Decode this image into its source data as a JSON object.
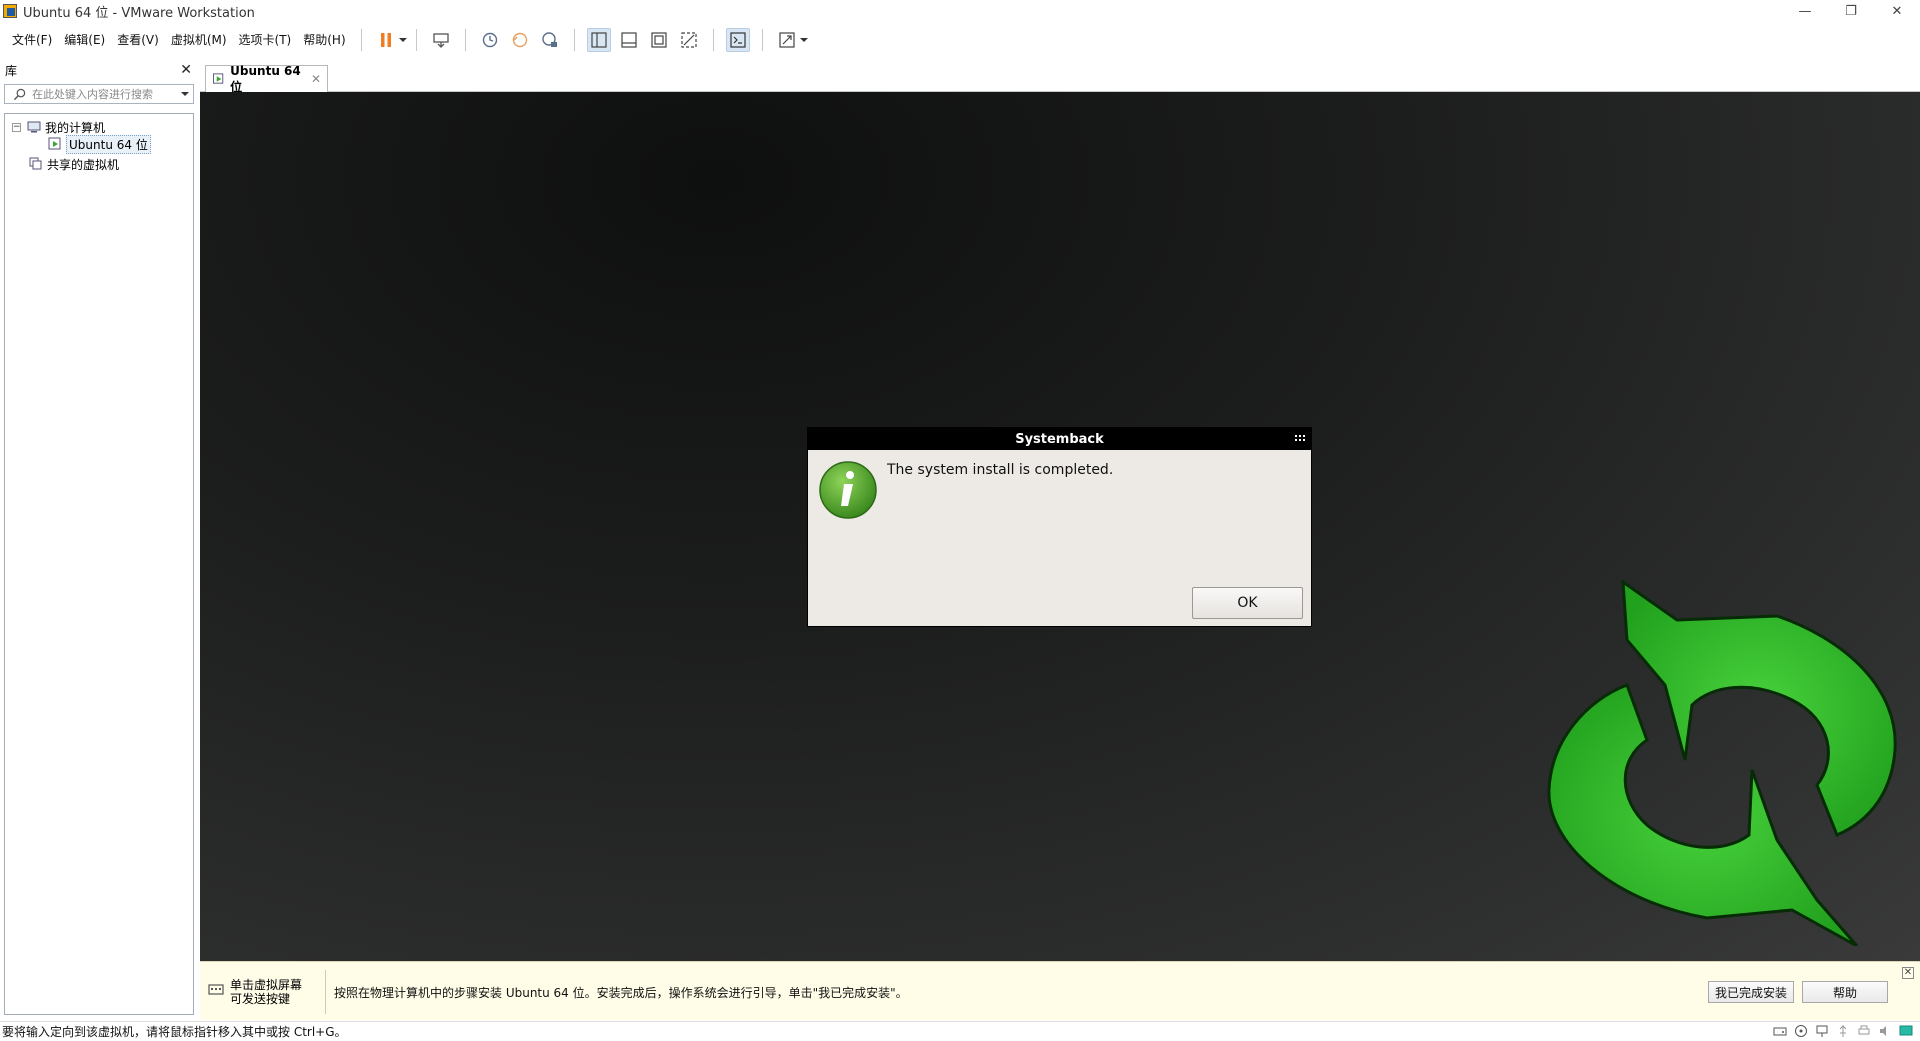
{
  "window": {
    "title": "Ubuntu 64 位 - VMware Workstation",
    "minimize": "—",
    "restore": "❐",
    "close": "✕"
  },
  "menu": {
    "file": "文件(F)",
    "edit": "编辑(E)",
    "view": "查看(V)",
    "vm": "虚拟机(M)",
    "tabs": "选项卡(T)",
    "help": "帮助(H)"
  },
  "library": {
    "title": "库",
    "close": "✕",
    "search_placeholder": "在此处键入内容进行搜索",
    "tree": {
      "my_computer": "我的计算机",
      "vm_name": "Ubuntu 64 位",
      "shared_vms": "共享的虚拟机"
    }
  },
  "tab": {
    "label": "Ubuntu 64 位",
    "close": "✕"
  },
  "dialog": {
    "title": "Systemback",
    "message": "The system install is completed.",
    "ok": "OK"
  },
  "hint": {
    "left_line1": "单击虚拟屏幕",
    "left_line2": "可发送按键",
    "message": "按照在物理计算机中的步骤安装 Ubuntu 64 位。安装完成后，操作系统会进行引导，单击\"我已完成安装\"。",
    "finish_button": "我已完成安装",
    "help_button": "帮助",
    "close": "✕"
  },
  "status": {
    "text": "要将输入定向到该虚拟机，请将鼠标指针移入其中或按 Ctrl+G。"
  },
  "colors": {
    "logo_green": "#2fb32a",
    "dialog_bg": "#edeae6",
    "pause_orange": "#f07d22"
  }
}
